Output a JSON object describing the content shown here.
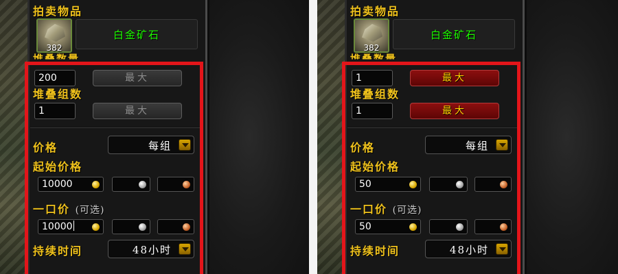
{
  "panels": [
    {
      "title": "拍卖物品",
      "item": {
        "name": "白金矿石",
        "count": "382"
      },
      "stack_size_label": "堆叠数量",
      "stack_size_value": "200",
      "max_label_1": "最大",
      "stack_count_label": "堆叠组数",
      "stack_count_value": "1",
      "max_label_2": "最大",
      "max_enabled": false,
      "price_label": "价格",
      "price_mode": "每组",
      "start_price_label": "起始价格",
      "start_price_gold": "10000",
      "buyout_label": "一口价",
      "buyout_optional": "(可选)",
      "buyout_gold": "10000",
      "duration_label": "持续时间",
      "duration_value": "48小时"
    },
    {
      "title": "拍卖物品",
      "item": {
        "name": "白金矿石",
        "count": "382"
      },
      "stack_size_label": "堆叠数量",
      "stack_size_value": "1",
      "max_label_1": "最大",
      "stack_count_label": "堆叠组数",
      "stack_count_value": "1",
      "max_label_2": "最大",
      "max_enabled": true,
      "price_label": "价格",
      "price_mode": "每组",
      "start_price_label": "起始价格",
      "start_price_gold": "50",
      "buyout_label": "一口价",
      "buyout_optional": "(可选)",
      "buyout_gold": "50",
      "duration_label": "持续时间",
      "duration_value": "48小时"
    }
  ],
  "colors": {
    "highlight_border": "#e3151a",
    "label_gold": "#f0c21c",
    "item_name_green": "#1eff00"
  },
  "icons": {
    "item": "platinum-ore-icon",
    "dropdown": "dropdown-arrow-icon",
    "gold": "gold-coin-icon",
    "silver": "silver-coin-icon",
    "copper": "copper-coin-icon"
  }
}
